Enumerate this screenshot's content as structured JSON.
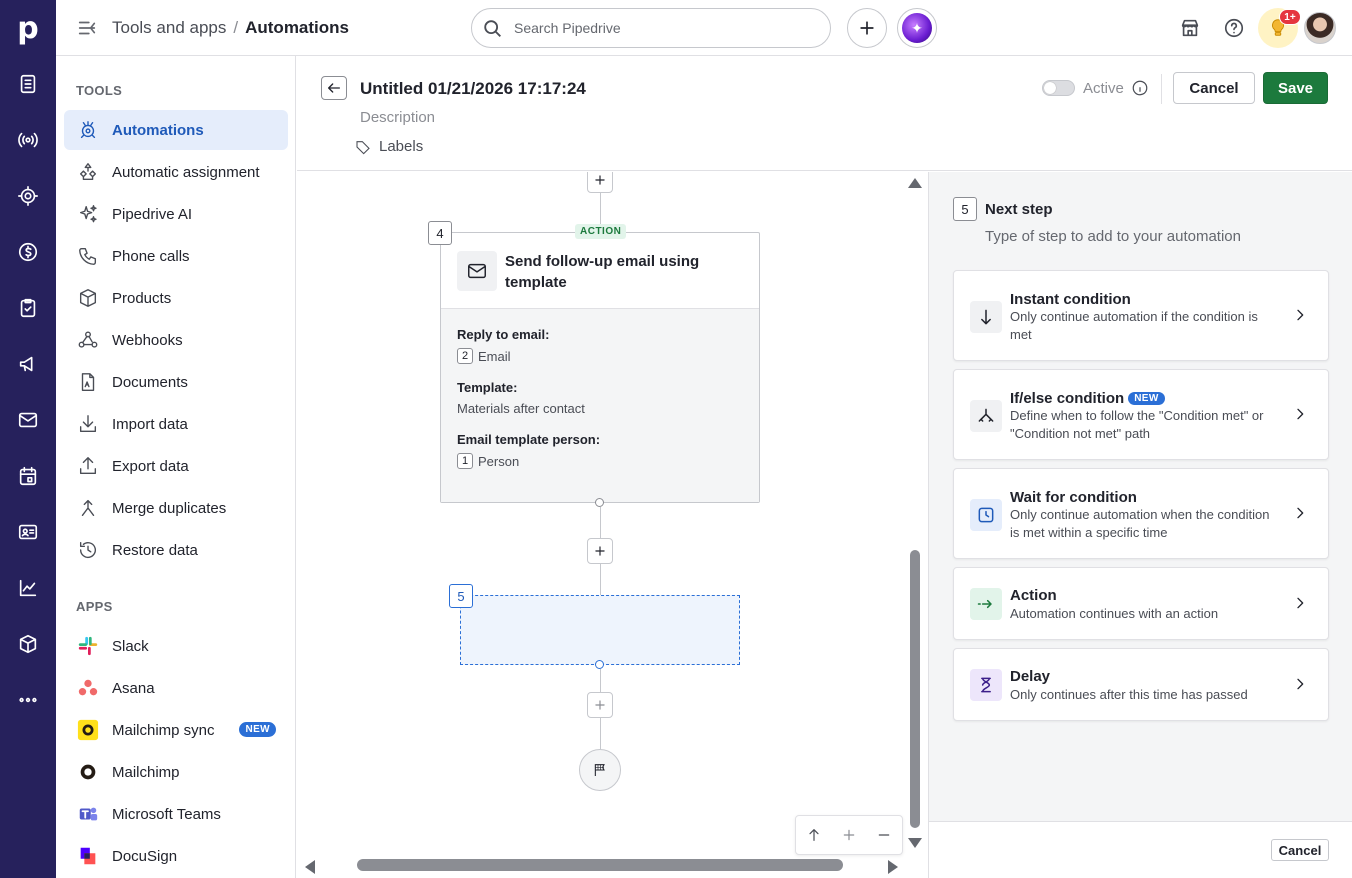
{
  "app": {
    "logo": "p"
  },
  "rail": {
    "items": [
      "deals-icon",
      "leads-icon",
      "focus-icon",
      "money-icon",
      "activities-icon",
      "campaigns-icon",
      "mail-icon",
      "calendar-icon",
      "contacts-icon",
      "insights-icon",
      "products-icon",
      "more-icon"
    ]
  },
  "header": {
    "breadcrumb": [
      "Tools and apps",
      "/",
      "Automations"
    ],
    "search_placeholder": "Search Pipedrive",
    "notification_count": "1+"
  },
  "tools": {
    "tools_heading": "TOOLS",
    "items": [
      {
        "label": "Automations",
        "icon": "automations-icon",
        "active": true
      },
      {
        "label": "Automatic assignment",
        "icon": "assignment-icon"
      },
      {
        "label": "Pipedrive AI",
        "icon": "sparkle-icon"
      },
      {
        "label": "Phone calls",
        "icon": "phone-icon"
      },
      {
        "label": "Products",
        "icon": "box-icon"
      },
      {
        "label": "Webhooks",
        "icon": "webhook-icon"
      },
      {
        "label": "Documents",
        "icon": "document-icon"
      },
      {
        "label": "Import data",
        "icon": "import-icon"
      },
      {
        "label": "Export data",
        "icon": "export-icon"
      },
      {
        "label": "Merge duplicates",
        "icon": "merge-icon"
      },
      {
        "label": "Restore data",
        "icon": "restore-icon"
      }
    ],
    "apps_heading": "APPS",
    "apps": [
      {
        "label": "Slack",
        "icon": "slack-icon"
      },
      {
        "label": "Asana",
        "icon": "asana-icon"
      },
      {
        "label": "Mailchimp sync",
        "icon": "mailchimp-icon",
        "badge": "NEW"
      },
      {
        "label": "Mailchimp",
        "icon": "mailchimp-icon"
      },
      {
        "label": "Microsoft Teams",
        "icon": "teams-icon"
      },
      {
        "label": "DocuSign",
        "icon": "docusign-icon"
      }
    ]
  },
  "editor": {
    "title": "Untitled 01/21/2026 17:17:24",
    "description_placeholder": "Description",
    "labels": "Labels",
    "active_label": "Active",
    "cancel": "Cancel",
    "save": "Save"
  },
  "canvas": {
    "node": {
      "step": "4",
      "tag": "ACTION",
      "title": "Send follow-up email using template",
      "fields": [
        {
          "label": "Reply to email:",
          "chip": "2",
          "value": "Email"
        },
        {
          "label": "Template:",
          "chip": "",
          "value": "Materials after contact"
        },
        {
          "label": "Email template person:",
          "chip": "1",
          "value": "Person"
        }
      ]
    },
    "placeholder_step": "5"
  },
  "next_step": {
    "step": "5",
    "title": "Next step",
    "subtitle": "Type of step to add to your automation",
    "options": [
      {
        "title": "Instant condition",
        "desc": "Only continue automation if the condition is met",
        "icon": "arrow-down-icon"
      },
      {
        "title": "If/else condition",
        "badge": "NEW",
        "desc": "Define when to follow the \"Condition met\" or \"Condition not met\" path",
        "icon": "branch-icon"
      },
      {
        "title": "Wait for condition",
        "desc": "Only continue automation when the condition is met within a specific time",
        "icon": "clock-icon"
      },
      {
        "title": "Action",
        "desc": "Automation continues with an action",
        "icon": "action-arrow-icon"
      },
      {
        "title": "Delay",
        "desc": "Only continues after this time has passed",
        "icon": "hourglass-icon"
      }
    ],
    "cancel": "Cancel"
  },
  "colors": {
    "rail": "#26215c",
    "accent": "#1f5ab9",
    "save": "#1c7a3d"
  }
}
